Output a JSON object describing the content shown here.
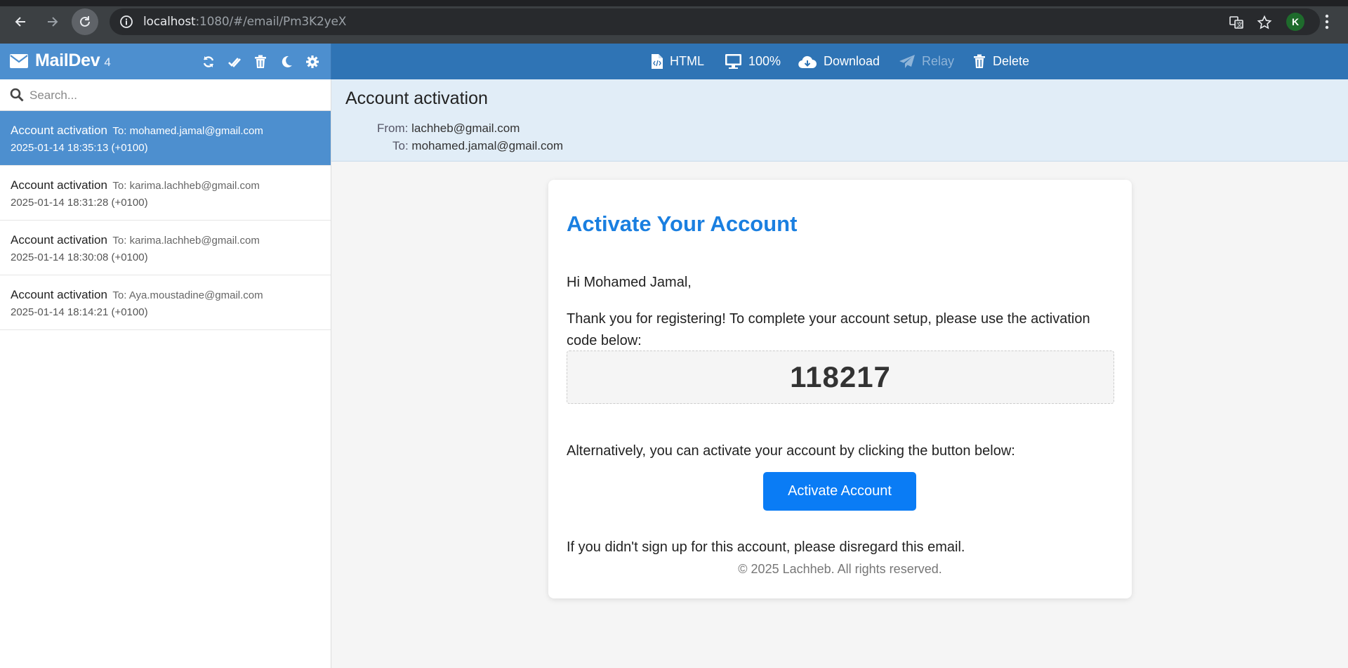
{
  "browser": {
    "url_host": "localhost",
    "url_path": ":1080/#/email/Pm3K2yeX",
    "avatar_letter": "K"
  },
  "app": {
    "name": "MailDev",
    "email_count": "4"
  },
  "toolbar": {
    "html_label": "HTML",
    "zoom_label": "100%",
    "download_label": "Download",
    "relay_label": "Relay",
    "delete_label": "Delete"
  },
  "search": {
    "placeholder": "Search..."
  },
  "emails": [
    {
      "subject": "Account activation",
      "to": "To: mohamed.jamal@gmail.com",
      "date": "2025-01-14 18:35:13 (+0100)",
      "active": true
    },
    {
      "subject": "Account activation",
      "to": "To: karima.lachheb@gmail.com",
      "date": "2025-01-14 18:31:28 (+0100)",
      "active": false
    },
    {
      "subject": "Account activation",
      "to": "To: karima.lachheb@gmail.com",
      "date": "2025-01-14 18:30:08 (+0100)",
      "active": false
    },
    {
      "subject": "Account activation",
      "to": "To: Aya.moustadine@gmail.com",
      "date": "2025-01-14 18:14:21 (+0100)",
      "active": false
    }
  ],
  "message": {
    "subject": "Account activation",
    "from_label": "From:",
    "from": "lachheb@gmail.com",
    "to_label": "To:",
    "to": "mohamed.jamal@gmail.com"
  },
  "email_body": {
    "title": "Activate Your Account",
    "greeting": "Hi Mohamed Jamal,",
    "intro": "Thank you for registering! To complete your account setup, please use the activation code below:",
    "code": "118217",
    "alternative": "Alternatively, you can activate your account by clicking the button below:",
    "button_label": "Activate Account",
    "disclaimer": "If you didn't sign up for this account, please disregard this email.",
    "footer": "© 2025 Lachheb. All rights reserved."
  },
  "colors": {
    "sidebar_header": "#4d8fcf",
    "toolbar": "#2f74b5",
    "accent_title": "#1a7fe0",
    "button": "#0a7cf5"
  }
}
